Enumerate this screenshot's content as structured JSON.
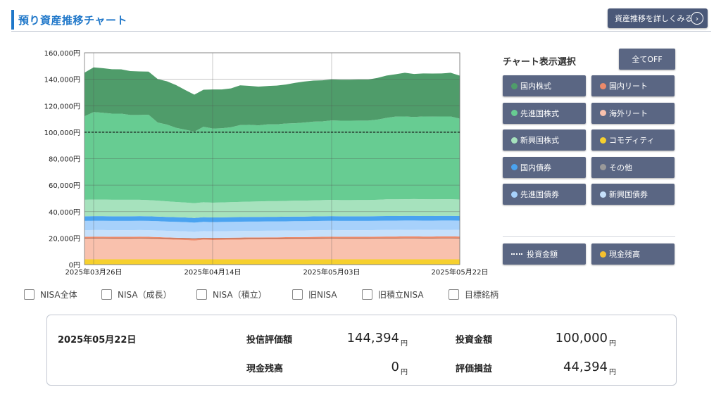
{
  "header": {
    "title": "預り資産推移チャート",
    "detail_button": "資産推移を詳しくみる",
    "detail_icon": "chevron-right-circle-icon"
  },
  "chart_data": {
    "type": "area",
    "stacked": true,
    "ylim": [
      0,
      160000
    ],
    "yticks": [
      "160,000円",
      "140,000円",
      "120,000円",
      "100,000円",
      "80,000円",
      "60,000円",
      "40,000円",
      "20,000円",
      "0円"
    ],
    "xticks": [
      "2025年03月26日",
      "2025年04月14日",
      "2025年05月03日",
      "2025年05月22日"
    ],
    "x_count": 42,
    "series": [
      {
        "name": "現金残高",
        "color": "#f6d02e",
        "values": [
          4000,
          4000,
          4000,
          4000,
          4000,
          4000,
          4000,
          4000,
          4000,
          4000,
          4000,
          4000,
          4000,
          4000,
          4000,
          4000,
          4000,
          4000,
          4000,
          4000,
          4000,
          4000,
          4000,
          4000,
          4000,
          4000,
          4000,
          4000,
          4000,
          4000,
          4000,
          4000,
          4000,
          4000,
          4000,
          4000,
          4000,
          4000,
          4000,
          4000,
          4000,
          4000
        ]
      },
      {
        "name": "海外リート",
        "color": "#f9c1ad",
        "values": [
          15500,
          15600,
          15600,
          15500,
          15500,
          15500,
          15600,
          15500,
          15300,
          15000,
          14800,
          14600,
          14200,
          14800,
          14600,
          14700,
          14800,
          14900,
          15000,
          15000,
          15100,
          15100,
          15200,
          15300,
          15300,
          15400,
          15500,
          15600,
          15500,
          15500,
          15500,
          15500,
          15600,
          15700,
          15700,
          15800,
          15800,
          15700,
          15700,
          15800,
          15800,
          15700
        ]
      },
      {
        "name": "国内リート",
        "color": "#ec8a6a",
        "values": [
          1500,
          1500,
          1500,
          1500,
          1500,
          1500,
          1500,
          1500,
          1500,
          1500,
          1500,
          1500,
          1500,
          1500,
          1500,
          1500,
          1500,
          1500,
          1500,
          1500,
          1500,
          1500,
          1500,
          1500,
          1500,
          1500,
          1500,
          1500,
          1500,
          1500,
          1500,
          1500,
          1500,
          1500,
          1500,
          1500,
          1500,
          1500,
          1500,
          1500,
          1500,
          1500
        ]
      },
      {
        "name": "新興国債券",
        "color": "#c6e0fb",
        "values": [
          5000,
          5000,
          5000,
          5000,
          5000,
          5000,
          5000,
          5000,
          5000,
          5000,
          5000,
          5000,
          5000,
          5000,
          5000,
          5000,
          5000,
          5000,
          5000,
          5000,
          5000,
          5000,
          5000,
          5000,
          5000,
          5000,
          5000,
          5000,
          5000,
          5000,
          5000,
          5000,
          5000,
          5000,
          5000,
          5000,
          5000,
          5000,
          5000,
          5000,
          5000,
          5000
        ]
      },
      {
        "name": "先進国債券",
        "color": "#a7d1fb",
        "values": [
          7000,
          7000,
          7000,
          7000,
          7000,
          7000,
          7000,
          7000,
          7000,
          7000,
          7000,
          7000,
          7000,
          7000,
          7000,
          7000,
          7000,
          7000,
          7000,
          7000,
          7000,
          7000,
          7000,
          7000,
          7000,
          7000,
          7000,
          7000,
          7000,
          7000,
          7000,
          7000,
          7000,
          7000,
          7000,
          7000,
          7000,
          7000,
          7000,
          7000,
          7000,
          7000
        ]
      },
      {
        "name": "国内債券",
        "color": "#4aa3f0",
        "values": [
          3500,
          3500,
          3500,
          3500,
          3500,
          3500,
          3500,
          3500,
          3500,
          3500,
          3500,
          3500,
          3500,
          3500,
          3500,
          3500,
          3500,
          3500,
          3500,
          3500,
          3500,
          3500,
          3500,
          3500,
          3500,
          3500,
          3500,
          3500,
          3500,
          3500,
          3500,
          3500,
          3500,
          3500,
          3500,
          3500,
          3500,
          3500,
          3500,
          3500,
          3500,
          3500
        ]
      },
      {
        "name": "新興国株式",
        "color": "#a6e2bd",
        "values": [
          12500,
          12600,
          12600,
          12500,
          12500,
          12500,
          12400,
          12200,
          12000,
          11800,
          11500,
          11300,
          11200,
          11300,
          11200,
          11300,
          11400,
          11500,
          11600,
          11700,
          11800,
          11800,
          11900,
          12000,
          12000,
          12100,
          12200,
          12300,
          12200,
          12200,
          12300,
          12300,
          12400,
          12600,
          12600,
          12600,
          12700,
          12700,
          12600,
          12600,
          12600,
          12500
        ]
      },
      {
        "name": "先進国株式",
        "color": "#67cc92",
        "values": [
          63000,
          66000,
          65500,
          65000,
          65000,
          64000,
          64000,
          64500,
          59000,
          58000,
          56000,
          55000,
          54000,
          57000,
          56000,
          56000,
          56500,
          58000,
          58000,
          57500,
          58000,
          58000,
          58500,
          58500,
          59000,
          59500,
          59500,
          60000,
          60000,
          60000,
          60000,
          60000,
          60500,
          61500,
          62500,
          62500,
          62000,
          62500,
          62500,
          62500,
          62500,
          61000
        ]
      },
      {
        "name": "国内株式",
        "color": "#4f9c6a",
        "values": [
          33000,
          33800,
          33700,
          33600,
          33500,
          33200,
          32900,
          32600,
          32800,
          32700,
          32300,
          30000,
          28000,
          28000,
          29500,
          29300,
          29400,
          30000,
          29400,
          29200,
          29000,
          29300,
          29400,
          30500,
          31000,
          31000,
          31000,
          31000,
          31000,
          31000,
          31000,
          31000,
          31500,
          32000,
          32000,
          33000,
          32500,
          32500,
          32500,
          32500,
          33000,
          32500
        ]
      }
    ],
    "investment_line": 100000,
    "grid": true
  },
  "selector": {
    "title": "チャート表示選択",
    "all_off": "全てOFF",
    "buttons": [
      {
        "label": "国内株式",
        "color": "#4f9c6a"
      },
      {
        "label": "国内リート",
        "color": "#ec8a6a"
      },
      {
        "label": "先進国株式",
        "color": "#67cc92"
      },
      {
        "label": "海外リート",
        "color": "#f9c1ad"
      },
      {
        "label": "新興国株式",
        "color": "#a6e2bd"
      },
      {
        "label": "コモディティ",
        "color": "#f6d02e"
      },
      {
        "label": "国内債券",
        "color": "#4aa3f0"
      },
      {
        "label": "その他",
        "color": "#9a9a9a"
      },
      {
        "label": "先進国債券",
        "color": "#a7d1fb"
      },
      {
        "label": "新興国債券",
        "color": "#c6e0fb"
      }
    ],
    "investment_label": "投資金額",
    "cash_label": "現金残高",
    "cash_color": "#f6c02e"
  },
  "filters": [
    "NISA全体",
    "NISA（成長）",
    "NISA（積立）",
    "旧NISA",
    "旧積立NISA",
    "目標銘柄"
  ],
  "summary": {
    "date": "2025年05月22日",
    "fund_value_label": "投信評価額",
    "fund_value": "144,394",
    "investment_label": "投資金額",
    "investment": "100,000",
    "cash_label": "現金残高",
    "cash": "0",
    "pnl_label": "評価損益",
    "pnl": "44,394",
    "unit": "円"
  }
}
